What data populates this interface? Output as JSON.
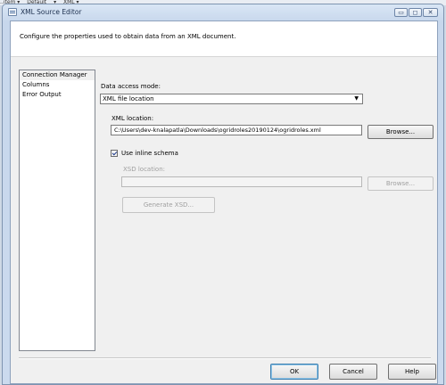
{
  "host_strip": {
    "items": [
      "..item ▾",
      "Default",
      "▾",
      "XML ▾"
    ]
  },
  "window": {
    "title": "XML Source Editor",
    "minimize": "▭",
    "maximize": "◻",
    "close": "✕"
  },
  "header": {
    "description": "Configure the properties used to obtain data from an XML document."
  },
  "nav": {
    "items": [
      {
        "label": "Connection Manager"
      },
      {
        "label": "Columns"
      },
      {
        "label": "Error Output"
      }
    ]
  },
  "form": {
    "data_access_mode_label": "Data access mode:",
    "data_access_mode_value": "XML file location",
    "xml_location_label": "XML location:",
    "xml_location_value": "C:\\Users\\dev-knalapatla\\Downloads\\ogridroles20190124\\ogridroles.xml",
    "browse_label": "Browse...",
    "use_inline_schema_label": "Use inline schema",
    "use_inline_schema_checked": true,
    "xsd_location_label": "XSD location:",
    "xsd_location_value": "",
    "xsd_browse_label": "Browse...",
    "generate_xsd_label": "Generate XSD..."
  },
  "footer": {
    "ok_label": "OK",
    "cancel_label": "Cancel",
    "help_label": "Help"
  }
}
